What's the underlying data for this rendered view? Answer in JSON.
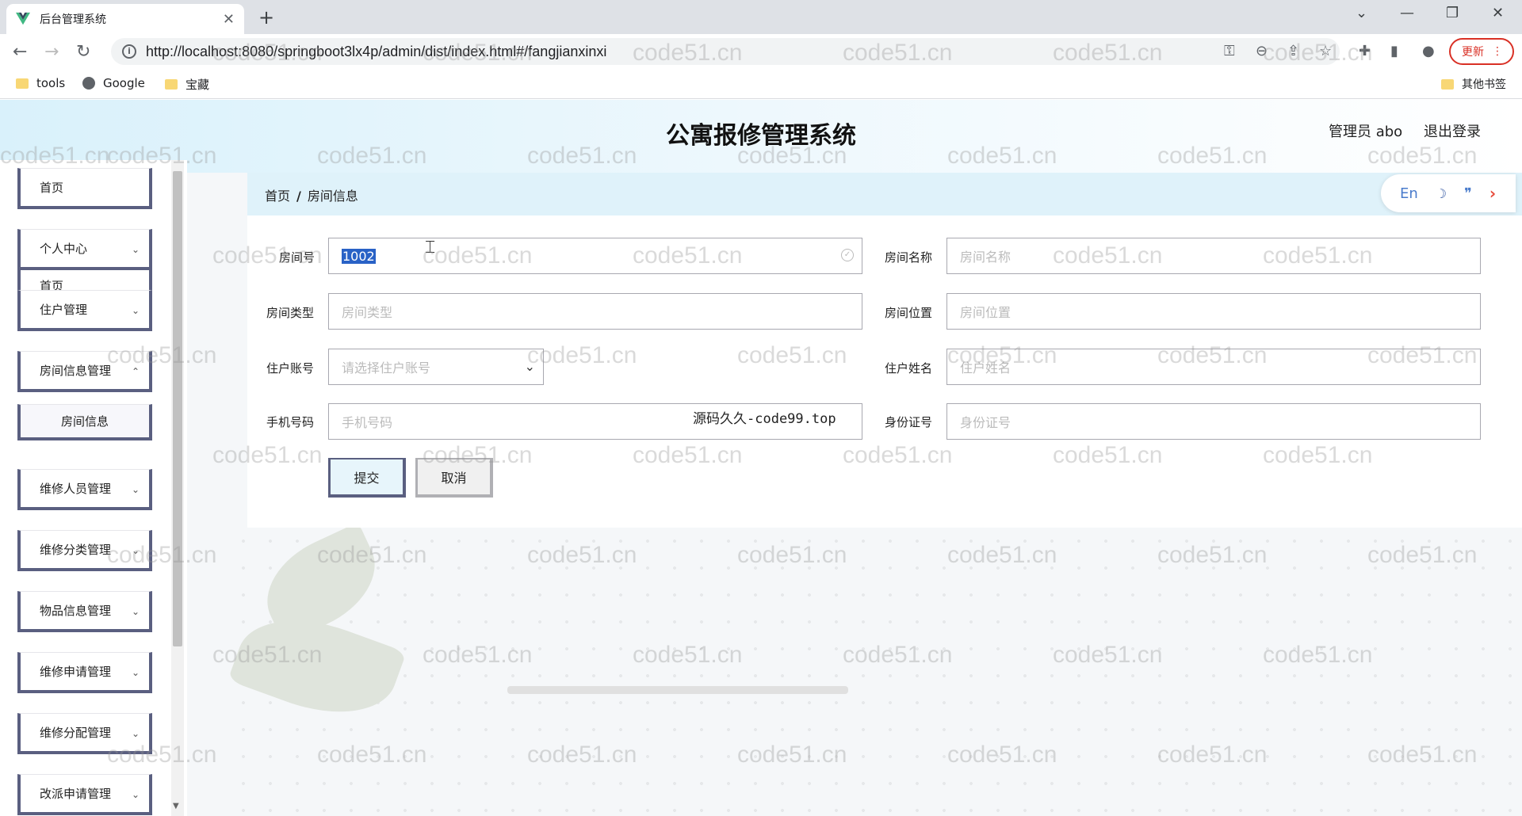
{
  "browser": {
    "tab_title": "后台管理系统",
    "url": "http://localhost:8080/springboot3lx4p/admin/dist/index.html#/fangjianxinxi",
    "update_label": "更新",
    "bookmarks": [
      "tools",
      "Google",
      "宝藏"
    ],
    "other_bookmarks": "其他书签"
  },
  "header": {
    "title": "公寓报修管理系统",
    "user": "管理员 abo",
    "logout": "退出登录"
  },
  "sidebar": {
    "items": [
      {
        "label": "首页"
      },
      {
        "label": "个人中心"
      },
      {
        "label": "住户管理"
      },
      {
        "label": "房间信息管理"
      },
      {
        "label": "房间信息"
      },
      {
        "label": "维修人员管理"
      },
      {
        "label": "维修分类管理"
      },
      {
        "label": "物品信息管理"
      },
      {
        "label": "维修申请管理"
      },
      {
        "label": "维修分配管理"
      },
      {
        "label": "改派申请管理"
      }
    ]
  },
  "breadcrumb": {
    "home": "首页",
    "sep": "/",
    "current": "房间信息"
  },
  "lang": {
    "en": "En"
  },
  "form": {
    "room_no_label": "房间号",
    "room_no_value": "1002",
    "room_name_label": "房间名称",
    "room_name_placeholder": "房间名称",
    "room_type_label": "房间类型",
    "room_type_placeholder": "房间类型",
    "room_location_label": "房间位置",
    "room_location_placeholder": "房间位置",
    "resident_account_label": "住户账号",
    "resident_account_placeholder": "请选择住户账号",
    "resident_name_label": "住户姓名",
    "resident_name_placeholder": "住户姓名",
    "phone_label": "手机号码",
    "phone_placeholder": "手机号码",
    "id_label": "身份证号",
    "id_placeholder": "身份证号",
    "submit": "提交",
    "cancel": "取消"
  },
  "overlay_text": "源码久久-code99.top",
  "watermark": "code51.cn"
}
